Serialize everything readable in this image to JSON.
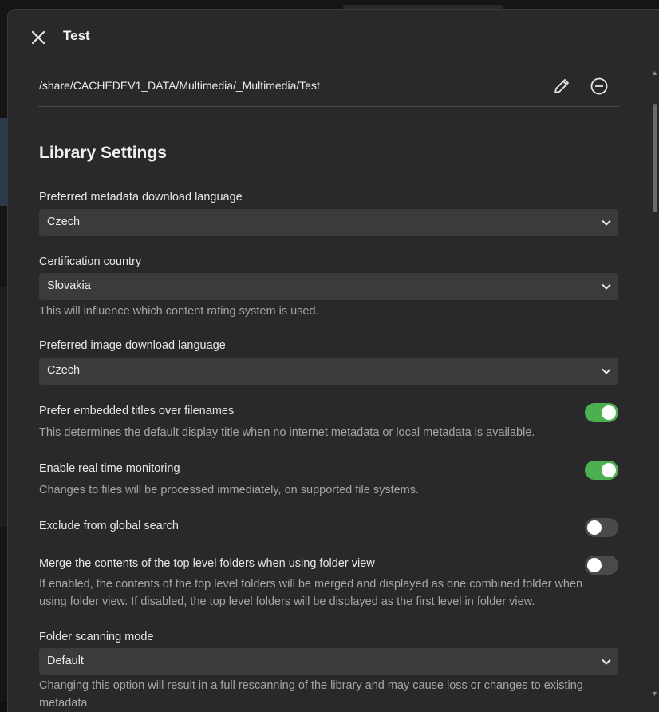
{
  "dialog": {
    "title": "Test"
  },
  "folder": {
    "path": "/share/CACHEDEV1_DATA/Multimedia/_Multimedia/Test"
  },
  "section": {
    "title": "Library Settings"
  },
  "settings": {
    "metadata_language": {
      "label": "Preferred metadata download language",
      "value": "Czech"
    },
    "certification_country": {
      "label": "Certification country",
      "value": "Slovakia",
      "help": "This will influence which content rating system is used."
    },
    "image_language": {
      "label": "Preferred image download language",
      "value": "Czech"
    },
    "embedded_titles": {
      "label": "Prefer embedded titles over filenames",
      "help": "This determines the default display title when no internet metadata or local metadata is available.",
      "enabled": true
    },
    "realtime_monitoring": {
      "label": "Enable real time monitoring",
      "help": "Changes to files will be processed immediately, on supported file systems.",
      "enabled": true
    },
    "exclude_global_search": {
      "label": "Exclude from global search",
      "enabled": false
    },
    "merge_top_folders": {
      "label": "Merge the contents of the top level folders when using folder view",
      "help_line1": "If enabled, the contents of the top level folders will be merged and displayed as one combined folder when",
      "help_line2": "using folder view. If disabled, the top level folders will be displayed as the first level in folder view.",
      "enabled": false
    },
    "scanning_mode": {
      "label": "Folder scanning mode",
      "value": "Default",
      "help_line1": "Changing this option will result in a full rescanning of the library and may cause loss or changes to existing",
      "help_line2": "metadata."
    }
  },
  "icons": {
    "close": "close-icon",
    "edit": "pencil-icon",
    "remove": "minus-circle-icon",
    "chevron": "chevron-down-icon"
  },
  "colors": {
    "dialog_bg": "#29292b",
    "field_bg": "#3b3b3d",
    "toggle_on": "#4caf50",
    "toggle_off": "#4a4a4c"
  }
}
